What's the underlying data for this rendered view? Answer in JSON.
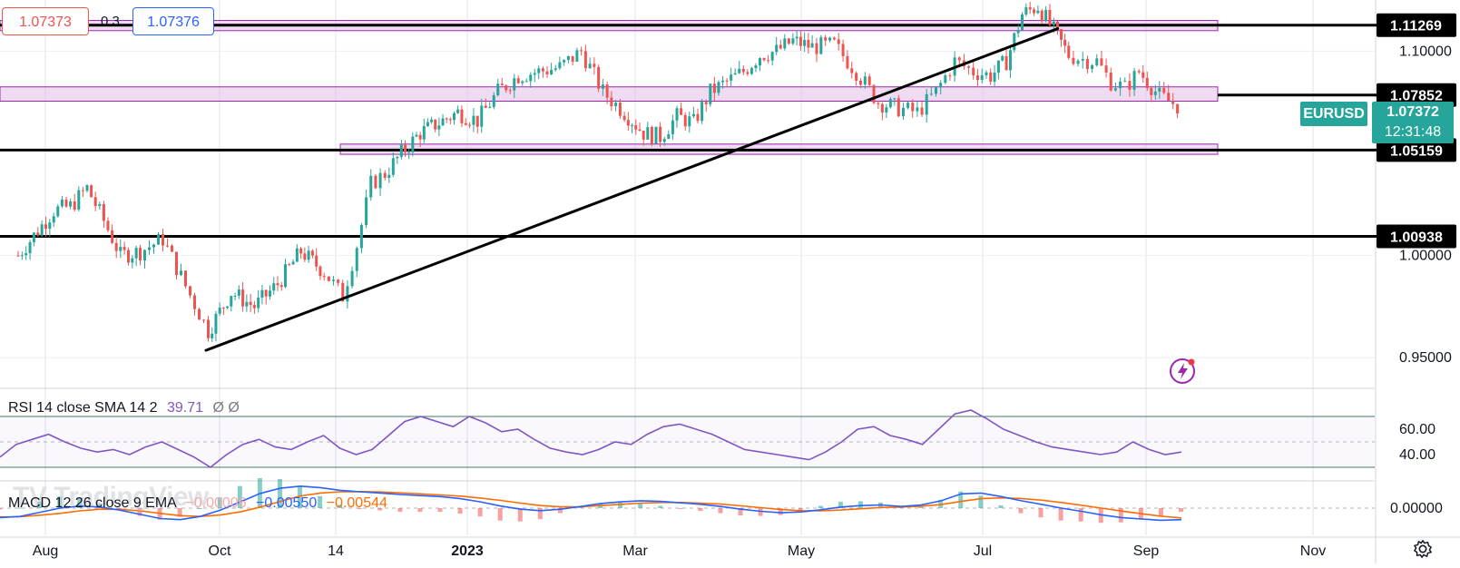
{
  "symbol": "EURUSD",
  "order_panel": {
    "sell_price": "1.07373",
    "spread": "0.3",
    "buy_price": "1.07376"
  },
  "last_price": "1.07372",
  "countdown": "12:31:48",
  "colors": {
    "up": "#26a69a",
    "down": "#ef5350",
    "zone_fill": "#e1bee7",
    "zone_stroke": "#9c27b0",
    "rsi": "#7e57c2",
    "macd": "#2962ff",
    "signal": "#ff6d00",
    "price_tag": "#26a69a"
  },
  "icons": {
    "flash": "lightning-icon",
    "settings": "gear-icon"
  },
  "chart_data": [
    {
      "type": "candlestick",
      "series_name": "EURUSD",
      "x_tick_labels": [
        "Aug",
        "Oct",
        "14",
        "2023",
        "Mar",
        "May",
        "Jul",
        "Sep",
        "Nov"
      ],
      "y_tick_labels": [
        "1.10000",
        "1.00000",
        "0.95000"
      ],
      "ylim": [
        0.935,
        1.125
      ],
      "key_levels": [
        {
          "label": "1.11269",
          "value": 1.11269
        },
        {
          "label": "1.07852",
          "value": 1.07852
        },
        {
          "label": "1.05159",
          "value": 1.05159
        },
        {
          "label": "1.00938",
          "value": 1.00938
        }
      ],
      "zones": [
        {
          "low": 1.11,
          "high": 1.115
        },
        {
          "low": 1.0755,
          "high": 1.0825
        },
        {
          "low": 1.0495,
          "high": 1.0545
        }
      ],
      "trendline": {
        "start": [
          "Sep 2022",
          0.9536
        ],
        "end": [
          "Jul 2023",
          1.111
        ]
      },
      "close_points": [
        [
          "Jul 2022",
          1.0
        ],
        [
          "Aug 2022",
          1.022
        ],
        [
          "Aug 2022",
          1.024
        ],
        [
          "Aug 2022",
          1.033
        ],
        [
          "Aug 2022",
          1.017
        ],
        [
          "Aug 2022",
          1.0
        ],
        [
          "Sep 2022",
          1.002
        ],
        [
          "Sep 2022",
          1.008
        ],
        [
          "Sep 2022",
          0.985
        ],
        [
          "Sep 2022",
          0.963
        ],
        [
          "Oct 2022",
          0.982
        ],
        [
          "Oct 2022",
          0.975
        ],
        [
          "Oct 2022",
          0.986
        ],
        [
          "Oct 2022",
          1.002
        ],
        [
          "Oct 2022",
          0.992
        ],
        [
          "Nov 2022",
          0.98
        ],
        [
          "Nov 2022",
          1.005
        ],
        [
          "Nov 2022",
          1.035
        ],
        [
          "Nov 2022",
          1.04
        ],
        [
          "Dec 2022",
          1.05
        ],
        [
          "Dec 2022",
          1.06
        ],
        [
          "Dec 2022",
          1.065
        ],
        [
          "Dec 2022",
          1.07
        ],
        [
          "Jan 2023",
          1.066
        ],
        [
          "Jan 2023",
          1.08
        ],
        [
          "Jan 2023",
          1.088
        ],
        [
          "Jan 2023",
          1.09
        ],
        [
          "Feb 2023",
          1.092
        ],
        [
          "Feb 2023",
          1.1
        ],
        [
          "Feb 2023",
          1.08
        ],
        [
          "Feb 2023",
          1.07
        ],
        [
          "Mar 2023",
          1.06
        ],
        [
          "Mar 2023",
          1.058
        ],
        [
          "Mar 2023",
          1.068
        ],
        [
          "Mar 2023",
          1.065
        ],
        [
          "Mar 2023",
          1.08
        ],
        [
          "Apr 2023",
          1.085
        ],
        [
          "Apr 2023",
          1.09
        ],
        [
          "Apr 2023",
          1.098
        ],
        [
          "Apr 2023",
          1.1
        ],
        [
          "Apr 2023",
          1.105
        ],
        [
          "May 2023",
          1.102
        ],
        [
          "May 2023",
          1.103
        ],
        [
          "May 2023",
          1.09
        ],
        [
          "May 2023",
          1.075
        ],
        [
          "Jun 2023",
          1.072
        ],
        [
          "Jun 2023",
          1.07
        ],
        [
          "Jun 2023",
          1.08
        ],
        [
          "Jun 2023",
          1.095
        ],
        [
          "Jun 2023",
          1.09
        ],
        [
          "Jul 2023",
          1.088
        ],
        [
          "Jul 2023",
          1.095
        ],
        [
          "Jul 2023",
          1.118
        ],
        [
          "Jul 2023",
          1.122
        ],
        [
          "Jul 2023",
          1.11
        ],
        [
          "Aug 2023",
          1.098
        ],
        [
          "Aug 2023",
          1.096
        ],
        [
          "Aug 2023",
          1.095
        ],
        [
          "Aug 2023",
          1.085
        ],
        [
          "Aug 2023",
          1.082
        ],
        [
          "Aug 2023",
          1.09
        ],
        [
          "Sep 2023",
          1.078
        ],
        [
          "Sep 2023",
          1.071
        ],
        [
          "Sep 2023",
          1.074
        ]
      ]
    },
    {
      "type": "line",
      "indicator": "RSI",
      "label": "RSI 14 close SMA 14 2",
      "value_text": "39.71",
      "extra_text": "Ø Ø",
      "y_tick_labels": [
        "60.00",
        "40.00"
      ],
      "ylim": [
        20,
        80
      ],
      "band": [
        30,
        70
      ],
      "values": [
        38,
        48,
        52,
        56,
        50,
        45,
        42,
        44,
        40,
        46,
        50,
        44,
        38,
        30,
        40,
        48,
        52,
        46,
        44,
        50,
        55,
        45,
        40,
        44,
        55,
        66,
        70,
        66,
        62,
        70,
        65,
        58,
        60,
        52,
        45,
        42,
        40,
        44,
        50,
        48,
        56,
        62,
        64,
        60,
        56,
        50,
        44,
        42,
        40,
        38,
        36,
        42,
        50,
        60,
        62,
        55,
        52,
        48,
        60,
        72,
        75,
        68,
        60,
        55,
        50,
        46,
        44,
        42,
        40,
        42,
        50,
        44,
        40,
        42
      ]
    },
    {
      "type": "line",
      "indicator": "MACD",
      "label": "MACD 12 26 close 9 EMA",
      "histogram_text": "−0.00006",
      "macd_text": "−0.00550",
      "signal_text": "−0.00544",
      "y_tick_labels": [
        "0.00000"
      ],
      "ylim": [
        -0.013,
        0.013
      ],
      "macd": [
        -0.0045,
        -0.004,
        -0.002,
        0.0,
        0.001,
        0.0005,
        -0.001,
        -0.003,
        -0.005,
        -0.0055,
        -0.004,
        -0.001,
        0.003,
        0.007,
        0.0095,
        0.0105,
        0.0098,
        0.0085,
        0.0078,
        0.0072,
        0.0065,
        0.006,
        0.0055,
        0.0045,
        0.003,
        0.001,
        -0.0005,
        -0.0012,
        -0.0005,
        0.0008,
        0.0022,
        0.003,
        0.0035,
        0.0032,
        0.0025,
        0.0018,
        0.0008,
        -0.0005,
        -0.0015,
        -0.0022,
        -0.0018,
        -0.0008,
        0.0005,
        0.0012,
        0.0015,
        0.0008,
        0.0015,
        0.0035,
        0.0068,
        0.0072,
        0.0055,
        0.0035,
        0.0018,
        0.0,
        -0.0015,
        -0.0032,
        -0.0045,
        -0.0052,
        -0.0058,
        -0.0055
      ],
      "signal": [
        -0.0042,
        -0.0041,
        -0.0034,
        -0.0025,
        -0.0013,
        -0.0005,
        -0.0006,
        -0.0013,
        -0.0025,
        -0.0036,
        -0.004,
        -0.0033,
        -0.0018,
        0.0005,
        0.0032,
        0.0058,
        0.0072,
        0.0078,
        0.0079,
        0.0077,
        0.0073,
        0.0068,
        0.0063,
        0.0057,
        0.0048,
        0.0037,
        0.0024,
        0.0012,
        0.0006,
        0.0006,
        0.0012,
        0.0018,
        0.0024,
        0.0027,
        0.0027,
        0.0024,
        0.0019,
        0.0011,
        0.0002,
        -0.0007,
        -0.0012,
        -0.0013,
        -0.0009,
        -0.0003,
        0.0003,
        0.0005,
        0.0009,
        0.0017,
        0.0032,
        0.0045,
        0.0049,
        0.0046,
        0.0038,
        0.0027,
        0.0014,
        0.0,
        -0.0014,
        -0.0027,
        -0.0039,
        -0.0047
      ]
    }
  ]
}
